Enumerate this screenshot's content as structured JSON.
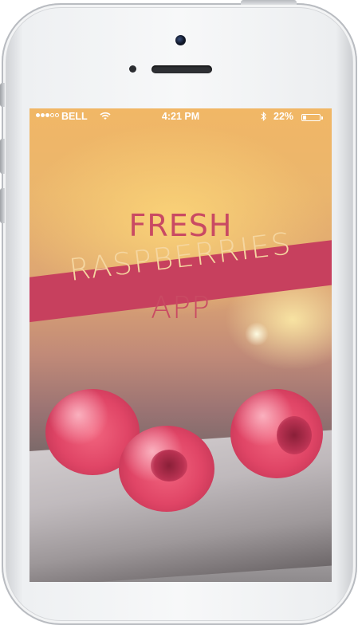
{
  "status_bar": {
    "carrier": "BELL",
    "time": "4:21 PM",
    "battery_percent": "22%",
    "battery_level": 0.22,
    "signal_bars_filled": 3,
    "signal_bars_total": 5,
    "icons": [
      "signal-dots-icon",
      "wifi-icon",
      "bluetooth-icon",
      "battery-icon"
    ]
  },
  "splash": {
    "title_line_1": "FRESH",
    "title_line_2": "RASPBERRIES",
    "title_line_3": "APP"
  },
  "colors": {
    "banner": "#c7405e",
    "title_pink": "#c94a63",
    "title_cream": "#f5d6a0",
    "status_text": "#ffffff"
  }
}
